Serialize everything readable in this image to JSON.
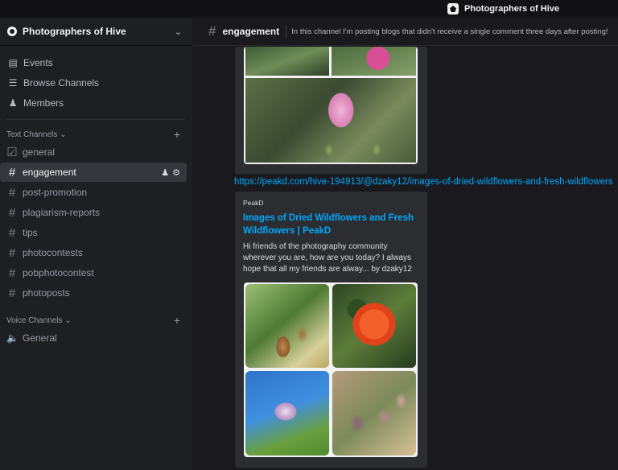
{
  "window": {
    "title": "Photographers of Hive"
  },
  "server": {
    "name": "Photographers of Hive"
  },
  "nav": [
    {
      "label": "Events",
      "icon": "calendar-icon"
    },
    {
      "label": "Browse Channels",
      "icon": "browse-channels-icon"
    },
    {
      "label": "Members",
      "icon": "members-icon"
    }
  ],
  "categories": {
    "text": "Text Channels",
    "voice": "Voice Channels"
  },
  "text_channels": [
    {
      "label": "general",
      "icon": "rules-icon"
    },
    {
      "label": "engagement",
      "icon": "hash-icon",
      "active": true
    },
    {
      "label": "post-promotion",
      "icon": "hash-icon"
    },
    {
      "label": "plagiarism-reports",
      "icon": "hash-icon"
    },
    {
      "label": "tips",
      "icon": "hash-icon"
    },
    {
      "label": "photocontests",
      "icon": "hash-icon"
    },
    {
      "label": "pobphotocontest",
      "icon": "hash-icon"
    },
    {
      "label": "photoposts",
      "icon": "hash-threads-icon"
    }
  ],
  "voice_channels": [
    {
      "label": "General",
      "icon": "speaker-icon"
    }
  ],
  "channel_header": {
    "name": "engagement",
    "topic": "In this channel I'm posting blogs that didn't receive a single comment three days after posting!"
  },
  "message": {
    "link": "https://peakd.com/hive-194913/@dzaky12/images-of-dried-wildflowers-and-fresh-wildflowers",
    "embed": {
      "provider": "PeakD",
      "title": "Images of Dried Wildflowers and Fresh Wildflowers | PeakD",
      "description": "Hi friends of the photography community wherever you are, how are you today? I always hope that all my friends are alway... by dzaky12"
    }
  },
  "colors": {
    "accent_link": "#00a8fc",
    "sidebar_bg": "#1e1f22",
    "main_bg": "#1a1a1e",
    "embed_bg": "#2b2d31"
  }
}
